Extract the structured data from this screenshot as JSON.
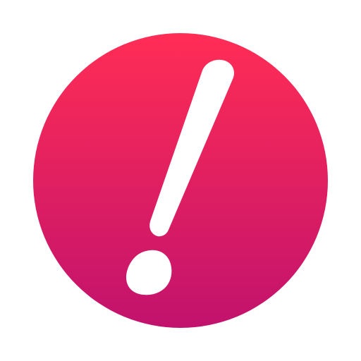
{
  "icon": {
    "name": "exclamation-icon",
    "colors": {
      "gradient_top": "#FF2D55",
      "gradient_bottom": "#C2126D",
      "glyph": "#FFFFFF",
      "background": "#FFFFFF"
    }
  }
}
